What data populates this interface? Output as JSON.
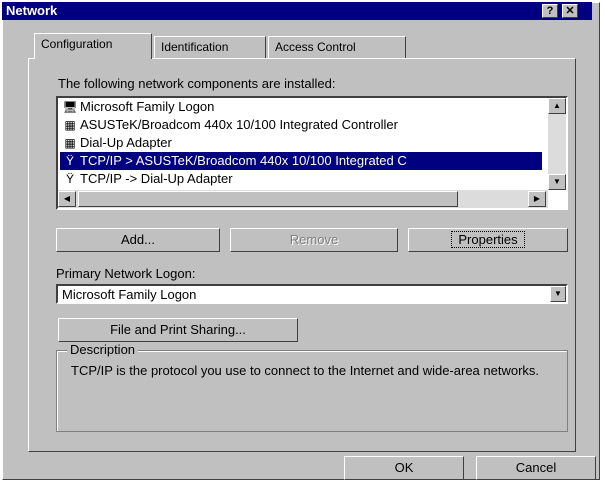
{
  "window": {
    "title": "Network",
    "help_btn": "?",
    "close_btn": "✕"
  },
  "tabs": [
    {
      "label": "Configuration",
      "active": true
    },
    {
      "label": "Identification",
      "active": false
    },
    {
      "label": "Access Control",
      "active": false
    }
  ],
  "components": {
    "label": "The following network components are installed:",
    "items": [
      {
        "label": "Microsoft Family Logon",
        "icon": "client-icon",
        "glyph": "🖥",
        "selected": false
      },
      {
        "label": "ASUSTeK/Broadcom 440x 10/100 Integrated Controller",
        "icon": "network-adapter-icon",
        "glyph": "▦",
        "selected": false
      },
      {
        "label": "Dial-Up Adapter",
        "icon": "network-adapter-icon",
        "glyph": "▦",
        "selected": false
      },
      {
        "label": "TCP/IP > ASUSTeK/Broadcom 440x 10/100 Integrated C",
        "icon": "protocol-icon",
        "glyph": "Ÿ",
        "selected": true
      },
      {
        "label": "TCP/IP -> Dial-Up Adapter",
        "icon": "protocol-icon",
        "glyph": "Ÿ",
        "selected": false
      }
    ]
  },
  "buttons": {
    "add": "Add...",
    "remove": "Remove",
    "properties": "Properties",
    "file_print": "File and Print Sharing...",
    "ok": "OK",
    "cancel": "Cancel"
  },
  "logon": {
    "label": "Primary Network Logon:",
    "value": "Microsoft Family Logon"
  },
  "description": {
    "legend": "Description",
    "text": "TCP/IP is the protocol you use to connect to the Internet and wide-area networks."
  },
  "colors": {
    "selection": "#000080",
    "titlebar": "#000080",
    "face": "#c0c0c0"
  }
}
